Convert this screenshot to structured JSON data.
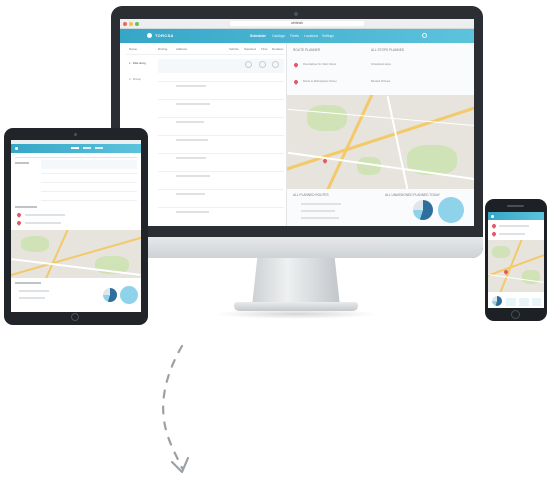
{
  "app": {
    "url": "whitelab",
    "logo": "TORCSA",
    "nav": [
      "Scheduler",
      "Catalogs",
      "Fleets",
      "Locations",
      "Settings"
    ],
    "active_nav": 0
  },
  "table": {
    "headers": [
      "Name",
      "Driving",
      "Address",
      "Vehicle",
      "Selected",
      "Time",
      "Duration"
    ],
    "first_row": "1 · Ride along",
    "second_row": "2 · Pickup"
  },
  "panel": {
    "title": "ROUTE PLANNER",
    "title_right": "ALL STOPS PLANNED",
    "stop1": "Roundabout St. Main Street",
    "stop1_right": "Scheduled stops",
    "stop2": "Route to Marketplace Street",
    "stop2_right": "Booked Pickups",
    "summary": "ALL PLANNED ROUTES",
    "summary_right": "ALL UNASSIGNED PLANNED TODAY"
  },
  "colors": {
    "accent": "#36a6c7",
    "pin": "#e25a6a",
    "road": "#f3c969",
    "park": "#cfe3b6",
    "donut_primary": "#2f6f9f",
    "donut_secondary": "#8fd3ea"
  },
  "icons": {
    "arrow": "curved-dashed-arrow-down-icon"
  }
}
